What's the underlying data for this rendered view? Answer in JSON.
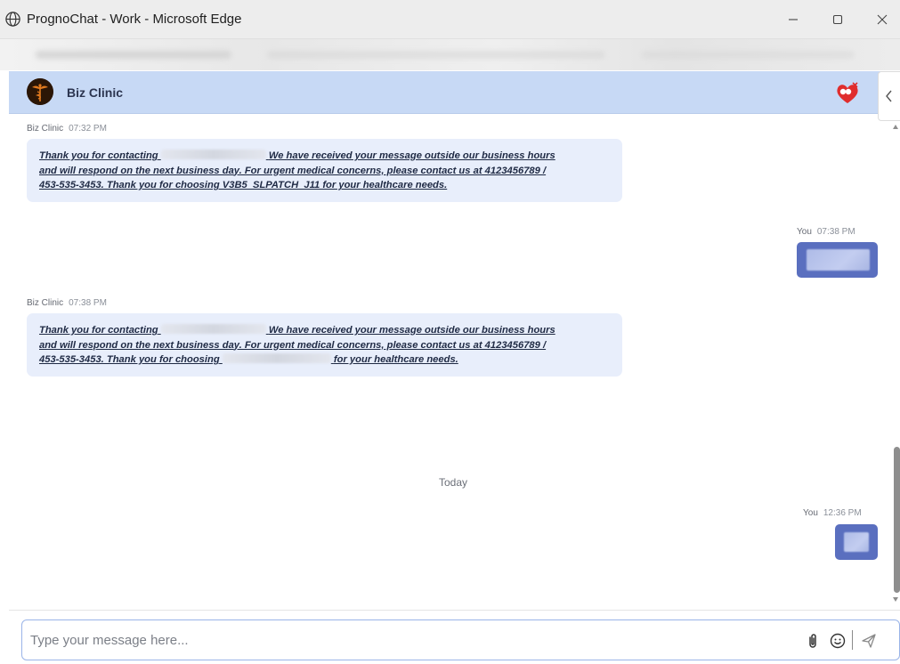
{
  "window": {
    "title": "PrognoChat - Work - Microsoft Edge",
    "controls": [
      "minimize-icon",
      "maximize-icon",
      "close-icon"
    ]
  },
  "chat": {
    "contact_name": "Biz Clinic",
    "header_color": "#c7d9f5",
    "outgoing_color": "#5a6fbf",
    "incoming_color": "#e8eefb"
  },
  "messages": [
    {
      "sender": "Biz Clinic",
      "time": "07:32 PM",
      "text_part1": "Thank you for contacting",
      "text_part2": "We have received your message outside our business hours",
      "text_line2": "and will respond on the next business day. For urgent medical concerns, please contact us at 4123456789 /",
      "text_line3a": "453-535-3453. Thank you for choosing V3B5_SLPATCH_J11 for your healthcare needs."
    },
    {
      "sender": "You",
      "time": "07:38 PM"
    },
    {
      "sender": "Biz Clinic",
      "time": "07:38 PM",
      "text_part1": "Thank you for contacting",
      "text_part2": "We have received your message outside our business hours",
      "text_line2": "and will respond on the next business day. For urgent medical concerns, please contact us at 4123456789 /",
      "text_line3a": "453-535-3453. Thank you for choosing",
      "text_line3b": "for your healthcare needs."
    },
    {
      "sender": "You",
      "time": "12:36 PM"
    }
  ],
  "divider_label": "Today",
  "composer": {
    "placeholder": "Type your message here...",
    "value": ""
  }
}
